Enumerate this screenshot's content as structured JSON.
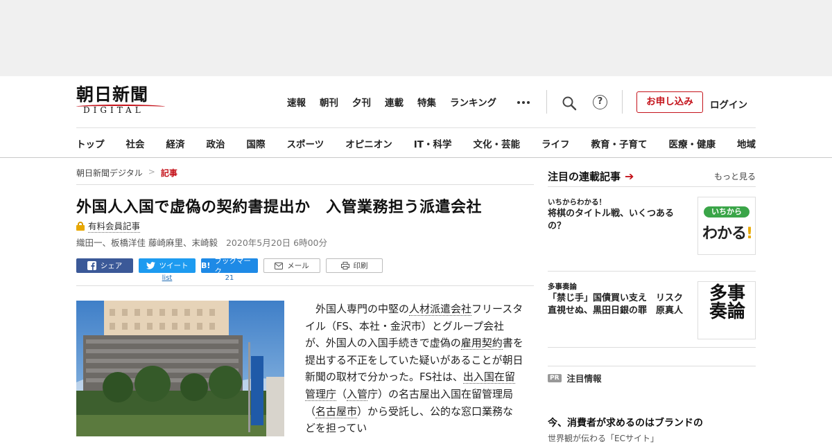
{
  "header": {
    "logo_text": "朝日新聞",
    "logo_sub": "DIGITAL",
    "top_nav": [
      "速報",
      "朝刊",
      "夕刊",
      "連載",
      "特集",
      "ランキング"
    ],
    "subscribe_label": "お申し込み",
    "login_label": "ログイン"
  },
  "category_nav": [
    "トップ",
    "社会",
    "経済",
    "政治",
    "国際",
    "スポーツ",
    "オピニオン",
    "IT・科学",
    "文化・芸能",
    "ライフ",
    "教育・子育て",
    "医療・健康",
    "地域"
  ],
  "breadcrumb": {
    "home": "朝日新聞デジタル",
    "sep": ">",
    "current": "記事"
  },
  "article": {
    "title": "外国人入国で虚偽の契約書提出か　入管業務担う派遣会社",
    "paid_label": "有料会員記事",
    "authors": "織田一、板橋洋佳 藤崎麻里、末崎毅",
    "date": "2020年5月20日 6時00分",
    "share": {
      "facebook": "シェア",
      "twitter": "ツイート",
      "twitter_count": "list",
      "hatena": "ブックマーク",
      "hatena_count": "21",
      "mail": "メール",
      "print": "印刷"
    },
    "body": {
      "p1": "外国人専門の中堅の",
      "l1": "人材派遣会社",
      "p2": "フリースタイル（FS、本社・金沢市）とグループ会社が、外国人の入国手続きで虚偽の",
      "l2": "雇用契約",
      "p3": "書を提出する不正をしていた疑いがあることが朝日新聞の取材で分かった。FS社は、",
      "l3": "出入国在留管理庁",
      "p4": "（",
      "l4": "入管",
      "p5": "庁）の名古屋出入国在留管理局（",
      "l5": "名古屋市",
      "p6": "）から受託し、公的な窓口業務などを担ってい"
    }
  },
  "sidebar": {
    "title": "注目の連載記事",
    "more": "もっと見る",
    "items": [
      {
        "category": "いちからわかる！",
        "headline": "将棋のタイトル戦、いくつあるの？",
        "thumb_top": "いちから",
        "thumb_bottom": "わかる",
        "thumb_mark": "!"
      },
      {
        "category": "多事奏論",
        "headline": "「禁じ手」国債買い支え　リスク直視せぬ、黒田日銀の罪　原真人",
        "thumb_text": "多事奏論"
      }
    ],
    "pr_badge": "PR",
    "pr_label": "注目情報",
    "pr_headline": "今、消費者が求めるのはブランドの",
    "pr_sub": "世界観が伝わる「ECサイト」"
  },
  "colors": {
    "brand_red": "#c4121a",
    "facebook": "#3b5998",
    "twitter": "#1d9bf0",
    "hatena": "#1e8ae6"
  },
  "icons": [
    "search-icon",
    "help-icon",
    "more-icon",
    "lock-icon",
    "facebook-icon",
    "twitter-icon",
    "hatena-icon",
    "mail-icon",
    "print-icon",
    "arrow-right-icon"
  ]
}
